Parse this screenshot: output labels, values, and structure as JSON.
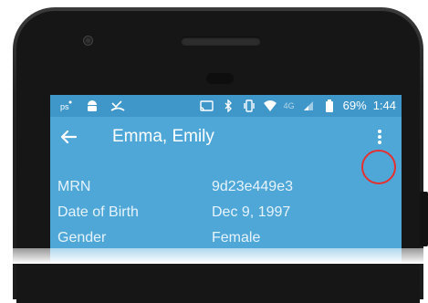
{
  "status_bar": {
    "battery_percent": "69%",
    "time": "1:44",
    "network_label": "4G",
    "left_icons": [
      "data-icon",
      "android-icon",
      "missed-call-icon"
    ],
    "right_icons": [
      "cast-icon",
      "bluetooth-icon",
      "vibrate-icon",
      "wifi-icon",
      "signal-icon",
      "battery-icon"
    ]
  },
  "app_bar": {
    "title": "Emma, Emily",
    "back_icon": "arrow-back-icon",
    "menu_icon": "more-vert-icon"
  },
  "patient": {
    "rows": [
      {
        "label": "MRN",
        "value": "9d23e449e3"
      },
      {
        "label": "Date of Birth",
        "value": "Dec 9, 1997"
      },
      {
        "label": "Gender",
        "value": "Female"
      }
    ]
  },
  "colors": {
    "app_background": "#4fa7d8",
    "status_bar": "#3f97c9",
    "highlight": "#e53030"
  }
}
